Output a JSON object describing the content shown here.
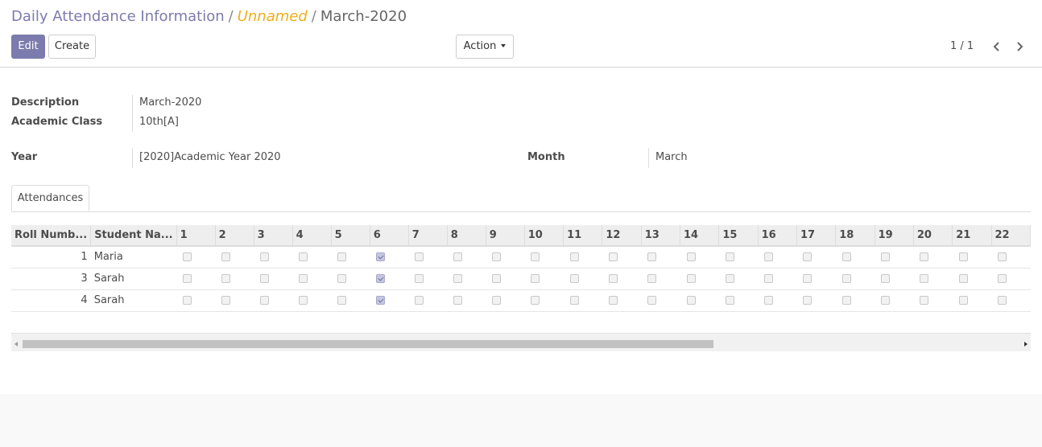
{
  "breadcrumb": {
    "root": "Daily Attendance Information",
    "separator": "/",
    "middle": "Unnamed",
    "current": "March-2020"
  },
  "buttons": {
    "edit": "Edit",
    "create": "Create",
    "action": "Action"
  },
  "pager": {
    "value": "1 / 1"
  },
  "form": {
    "description_label": "Description",
    "description": "March-2020",
    "academic_class_label": "Academic Class",
    "academic_class": "10th[A]",
    "year_label": "Year",
    "year": "[2020]Academic Year 2020",
    "month_label": "Month",
    "month": "March"
  },
  "tabs": [
    "Attendances"
  ],
  "grid": {
    "columns": [
      "Roll Numb...",
      "Student Na...",
      "1",
      "2",
      "3",
      "4",
      "5",
      "6",
      "7",
      "8",
      "9",
      "10",
      "11",
      "12",
      "13",
      "14",
      "15",
      "16",
      "17",
      "18",
      "19",
      "20",
      "21",
      "22"
    ],
    "rows": [
      {
        "roll": "1",
        "name": "Maria",
        "checked_day": 6
      },
      {
        "roll": "3",
        "name": "Sarah",
        "checked_day": 6
      },
      {
        "roll": "4",
        "name": "Sarah",
        "checked_day": 6
      }
    ]
  },
  "colors": {
    "primary": "#7c7bad",
    "highlight": "#f0ad1a",
    "checked": "#c6c6e0"
  }
}
